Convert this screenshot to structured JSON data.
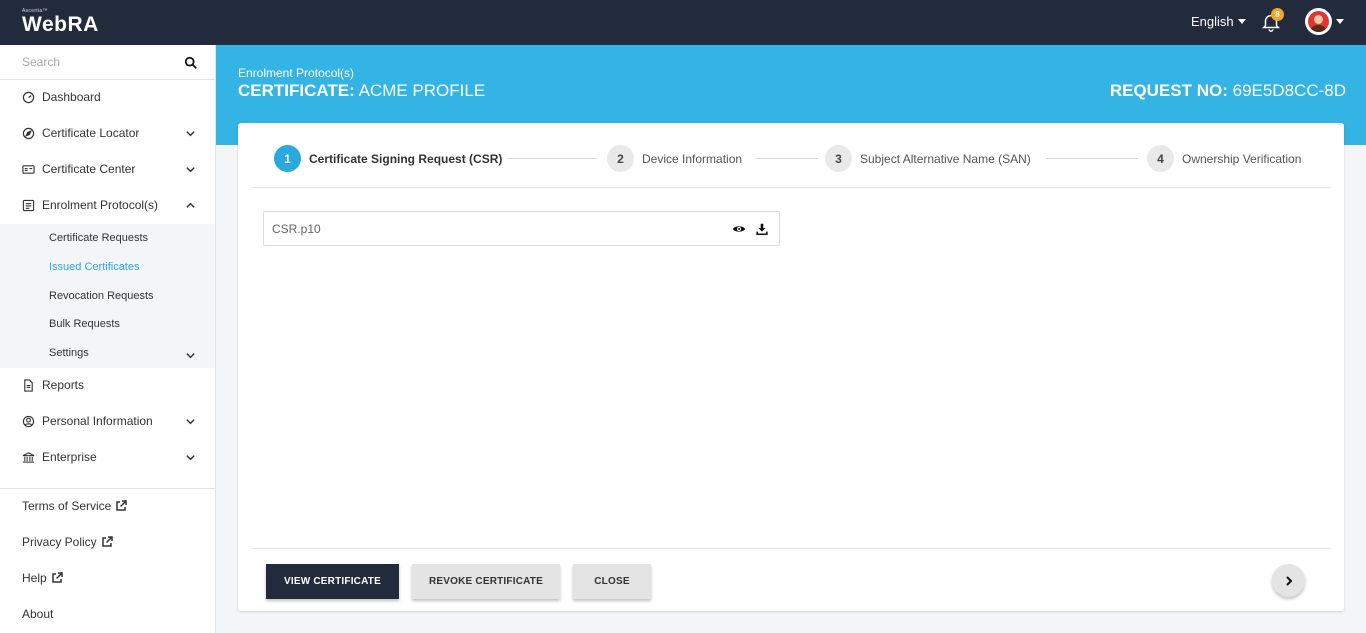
{
  "app": {
    "vendor": "Ascertia™",
    "name": "WebRA"
  },
  "header": {
    "language": "English",
    "notification_count": "8",
    "icons": {
      "notifications": "bell-icon",
      "user": "avatar-icon"
    }
  },
  "sidebar": {
    "search_placeholder": "Search",
    "items": [
      {
        "label": "Dashboard",
        "icon": "dashboard-icon"
      },
      {
        "label": "Certificate Locator",
        "icon": "compass-icon"
      },
      {
        "label": "Certificate Center",
        "icon": "id-card-icon"
      },
      {
        "label": "Enrolment Protocol(s)",
        "icon": "protocol-icon"
      },
      {
        "label": "Reports",
        "icon": "document-icon"
      },
      {
        "label": "Personal Information",
        "icon": "user-circle-icon"
      },
      {
        "label": "Enterprise",
        "icon": "bank-icon"
      }
    ],
    "submenu": [
      {
        "label": "Certificate Requests"
      },
      {
        "label": "Issued Certificates",
        "active": true
      },
      {
        "label": "Revocation Requests"
      },
      {
        "label": "Bulk Requests"
      },
      {
        "label": "Settings"
      }
    ],
    "footer": [
      {
        "label": "Terms of Service"
      },
      {
        "label": "Privacy Policy"
      },
      {
        "label": "Help"
      },
      {
        "label": "About"
      }
    ]
  },
  "banner": {
    "breadcrumb": "Enrolment Protocol(s)",
    "title_prefix": "CERTIFICATE:",
    "title_value": "ACME PROFILE",
    "request_label": "REQUEST NO:",
    "request_value": "69E5D8CC-8D"
  },
  "steps": [
    {
      "number": "1",
      "label": "Certificate Signing Request (CSR)",
      "active": true
    },
    {
      "number": "2",
      "label": "Device Information"
    },
    {
      "number": "3",
      "label": "Subject Alternative Name (SAN)"
    },
    {
      "number": "4",
      "label": "Ownership Verification"
    }
  ],
  "file": {
    "name": "CSR.p10",
    "icons": [
      "eye-icon",
      "download-icon"
    ]
  },
  "buttons": {
    "view": "VIEW CERTIFICATE",
    "revoke": "REVOKE CERTIFICATE",
    "close": "CLOSE"
  },
  "colors": {
    "topbar": "#222b3b",
    "banner": "#34b4e4",
    "accent": "#2aa8e0",
    "badge": "#f5a623"
  }
}
